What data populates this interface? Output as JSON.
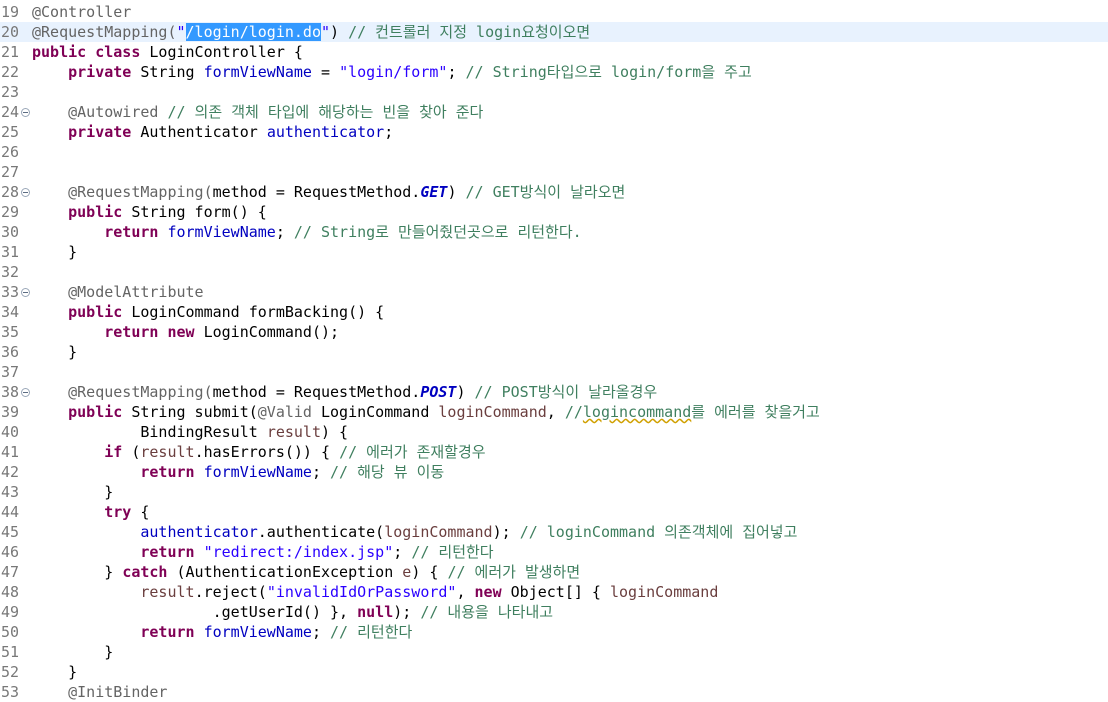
{
  "editor": {
    "file": "LoginController.java",
    "current_line": 20,
    "lines": [
      {
        "n": "19",
        "tokens": [
          {
            "t": "@Controller",
            "c": "ann"
          }
        ]
      },
      {
        "n": "20",
        "tokens": [
          {
            "t": "@RequestMapping(",
            "c": "ann"
          },
          {
            "t": "\"",
            "c": "str"
          },
          {
            "t": "/login/login.do",
            "c": "sel"
          },
          {
            "t": "\"",
            "c": "str"
          },
          {
            "t": ") ",
            "c": "pl"
          },
          {
            "t": "// 컨트롤러 지정 login요청이오면",
            "c": "cm"
          }
        ]
      },
      {
        "n": "21",
        "tokens": [
          {
            "t": "public class ",
            "c": "kw"
          },
          {
            "t": "LoginController {",
            "c": "pl"
          }
        ]
      },
      {
        "n": "22",
        "tokens": [
          {
            "t": "    ",
            "c": "pl"
          },
          {
            "t": "private ",
            "c": "kw"
          },
          {
            "t": "String ",
            "c": "pl"
          },
          {
            "t": "formViewName",
            "c": "fld"
          },
          {
            "t": " = ",
            "c": "pl"
          },
          {
            "t": "\"login/form\"",
            "c": "str"
          },
          {
            "t": "; ",
            "c": "pl"
          },
          {
            "t": "// String타입으로 login/form을 주고",
            "c": "cm"
          }
        ]
      },
      {
        "n": "23",
        "tokens": []
      },
      {
        "n": "24",
        "fold": true,
        "tokens": [
          {
            "t": "    ",
            "c": "pl"
          },
          {
            "t": "@Autowired ",
            "c": "ann"
          },
          {
            "t": "// 의존 객체 타입에 해당하는 빈을 찾아 준다",
            "c": "cm"
          }
        ]
      },
      {
        "n": "25",
        "tokens": [
          {
            "t": "    ",
            "c": "pl"
          },
          {
            "t": "private ",
            "c": "kw"
          },
          {
            "t": "Authenticator ",
            "c": "pl"
          },
          {
            "t": "authenticator",
            "c": "fld"
          },
          {
            "t": ";",
            "c": "pl"
          }
        ]
      },
      {
        "n": "26",
        "tokens": []
      },
      {
        "n": "27",
        "tokens": []
      },
      {
        "n": "28",
        "fold": true,
        "tokens": [
          {
            "t": "    ",
            "c": "pl"
          },
          {
            "t": "@RequestMapping(",
            "c": "ann"
          },
          {
            "t": "method = RequestMethod.",
            "c": "pl"
          },
          {
            "t": "GET",
            "c": "cst"
          },
          {
            "t": ") ",
            "c": "pl"
          },
          {
            "t": "// GET방식이 날라오면",
            "c": "cm"
          }
        ]
      },
      {
        "n": "29",
        "tokens": [
          {
            "t": "    ",
            "c": "pl"
          },
          {
            "t": "public ",
            "c": "kw"
          },
          {
            "t": "String form() {",
            "c": "pl"
          }
        ]
      },
      {
        "n": "30",
        "tokens": [
          {
            "t": "        ",
            "c": "pl"
          },
          {
            "t": "return ",
            "c": "kw"
          },
          {
            "t": "formViewName",
            "c": "fld"
          },
          {
            "t": "; ",
            "c": "pl"
          },
          {
            "t": "// String로 만들어줬던곳으로 리턴한다.",
            "c": "cm"
          }
        ]
      },
      {
        "n": "31",
        "tokens": [
          {
            "t": "    }",
            "c": "pl"
          }
        ]
      },
      {
        "n": "32",
        "tokens": []
      },
      {
        "n": "33",
        "fold": true,
        "tokens": [
          {
            "t": "    ",
            "c": "pl"
          },
          {
            "t": "@ModelAttribute",
            "c": "ann"
          }
        ]
      },
      {
        "n": "34",
        "tokens": [
          {
            "t": "    ",
            "c": "pl"
          },
          {
            "t": "public ",
            "c": "kw"
          },
          {
            "t": "LoginCommand formBacking() {",
            "c": "pl"
          }
        ]
      },
      {
        "n": "35",
        "tokens": [
          {
            "t": "        ",
            "c": "pl"
          },
          {
            "t": "return new ",
            "c": "kw"
          },
          {
            "t": "LoginCommand();",
            "c": "pl"
          }
        ]
      },
      {
        "n": "36",
        "tokens": [
          {
            "t": "    }",
            "c": "pl"
          }
        ]
      },
      {
        "n": "37",
        "tokens": []
      },
      {
        "n": "38",
        "fold": true,
        "tokens": [
          {
            "t": "    ",
            "c": "pl"
          },
          {
            "t": "@RequestMapping(",
            "c": "ann"
          },
          {
            "t": "method = RequestMethod.",
            "c": "pl"
          },
          {
            "t": "POST",
            "c": "cst"
          },
          {
            "t": ") ",
            "c": "pl"
          },
          {
            "t": "// POST방식이 날라올경우",
            "c": "cm"
          }
        ]
      },
      {
        "n": "39",
        "tokens": [
          {
            "t": "    ",
            "c": "pl"
          },
          {
            "t": "public ",
            "c": "kw"
          },
          {
            "t": "String submit(",
            "c": "pl"
          },
          {
            "t": "@Valid ",
            "c": "ann"
          },
          {
            "t": "LoginCommand ",
            "c": "pl"
          },
          {
            "t": "loginCommand",
            "c": "var"
          },
          {
            "t": ", ",
            "c": "pl"
          },
          {
            "t": "//",
            "c": "cm"
          },
          {
            "t": "logincommand",
            "c": "cmtypo"
          },
          {
            "t": "를 에러를 찾을거고",
            "c": "cm"
          }
        ]
      },
      {
        "n": "40",
        "tokens": [
          {
            "t": "            BindingResult ",
            "c": "pl"
          },
          {
            "t": "result",
            "c": "var"
          },
          {
            "t": ") {",
            "c": "pl"
          }
        ]
      },
      {
        "n": "41",
        "tokens": [
          {
            "t": "        ",
            "c": "pl"
          },
          {
            "t": "if ",
            "c": "kw"
          },
          {
            "t": "(",
            "c": "pl"
          },
          {
            "t": "result",
            "c": "var"
          },
          {
            "t": ".hasErrors()) { ",
            "c": "pl"
          },
          {
            "t": "// 에러가 존재할경우",
            "c": "cm"
          }
        ]
      },
      {
        "n": "42",
        "tokens": [
          {
            "t": "            ",
            "c": "pl"
          },
          {
            "t": "return ",
            "c": "kw"
          },
          {
            "t": "formViewName",
            "c": "fld"
          },
          {
            "t": "; ",
            "c": "pl"
          },
          {
            "t": "// 해당 뷰 이동",
            "c": "cm"
          }
        ]
      },
      {
        "n": "43",
        "tokens": [
          {
            "t": "        }",
            "c": "pl"
          }
        ]
      },
      {
        "n": "44",
        "tokens": [
          {
            "t": "        ",
            "c": "pl"
          },
          {
            "t": "try ",
            "c": "kw"
          },
          {
            "t": "{",
            "c": "pl"
          }
        ]
      },
      {
        "n": "45",
        "tokens": [
          {
            "t": "            ",
            "c": "pl"
          },
          {
            "t": "authenticator",
            "c": "fld"
          },
          {
            "t": ".authenticate(",
            "c": "pl"
          },
          {
            "t": "loginCommand",
            "c": "var"
          },
          {
            "t": "); ",
            "c": "pl"
          },
          {
            "t": "// loginCommand 의존객체에 집어넣고",
            "c": "cm"
          }
        ]
      },
      {
        "n": "46",
        "tokens": [
          {
            "t": "            ",
            "c": "pl"
          },
          {
            "t": "return ",
            "c": "kw"
          },
          {
            "t": "\"redirect:/index.jsp\"",
            "c": "str"
          },
          {
            "t": "; ",
            "c": "pl"
          },
          {
            "t": "// 리턴한다",
            "c": "cm"
          }
        ]
      },
      {
        "n": "47",
        "tokens": [
          {
            "t": "        } ",
            "c": "pl"
          },
          {
            "t": "catch ",
            "c": "kw"
          },
          {
            "t": "(AuthenticationException ",
            "c": "pl"
          },
          {
            "t": "e",
            "c": "var"
          },
          {
            "t": ") { ",
            "c": "pl"
          },
          {
            "t": "// 에러가 발생하면",
            "c": "cm"
          }
        ]
      },
      {
        "n": "48",
        "tokens": [
          {
            "t": "            ",
            "c": "pl"
          },
          {
            "t": "result",
            "c": "var"
          },
          {
            "t": ".reject(",
            "c": "pl"
          },
          {
            "t": "\"invalidIdOrPassword\"",
            "c": "str"
          },
          {
            "t": ", ",
            "c": "pl"
          },
          {
            "t": "new ",
            "c": "kw"
          },
          {
            "t": "Object[] { ",
            "c": "pl"
          },
          {
            "t": "loginCommand",
            "c": "var"
          }
        ]
      },
      {
        "n": "49",
        "tokens": [
          {
            "t": "                    .getUserId() }, ",
            "c": "pl"
          },
          {
            "t": "null",
            "c": "kw"
          },
          {
            "t": "); ",
            "c": "pl"
          },
          {
            "t": "// 내용을 나타내고",
            "c": "cm"
          }
        ]
      },
      {
        "n": "50",
        "tokens": [
          {
            "t": "            ",
            "c": "pl"
          },
          {
            "t": "return ",
            "c": "kw"
          },
          {
            "t": "formViewName",
            "c": "fld"
          },
          {
            "t": "; ",
            "c": "pl"
          },
          {
            "t": "// 리턴한다",
            "c": "cm"
          }
        ]
      },
      {
        "n": "51",
        "tokens": [
          {
            "t": "        }",
            "c": "pl"
          }
        ]
      },
      {
        "n": "52",
        "tokens": [
          {
            "t": "    }",
            "c": "pl"
          }
        ]
      },
      {
        "n": "53",
        "tokens": [
          {
            "t": "    @InitBinder",
            "c": "ann"
          }
        ]
      }
    ]
  },
  "colors": {
    "keyword": "#7f0055",
    "string": "#2a00ff",
    "comment": "#3f7f5f",
    "annotation": "#646464",
    "field": "#0000c0",
    "selection": "#3399ff",
    "current_line": "#e8f2fe",
    "line_number": "#787878"
  }
}
